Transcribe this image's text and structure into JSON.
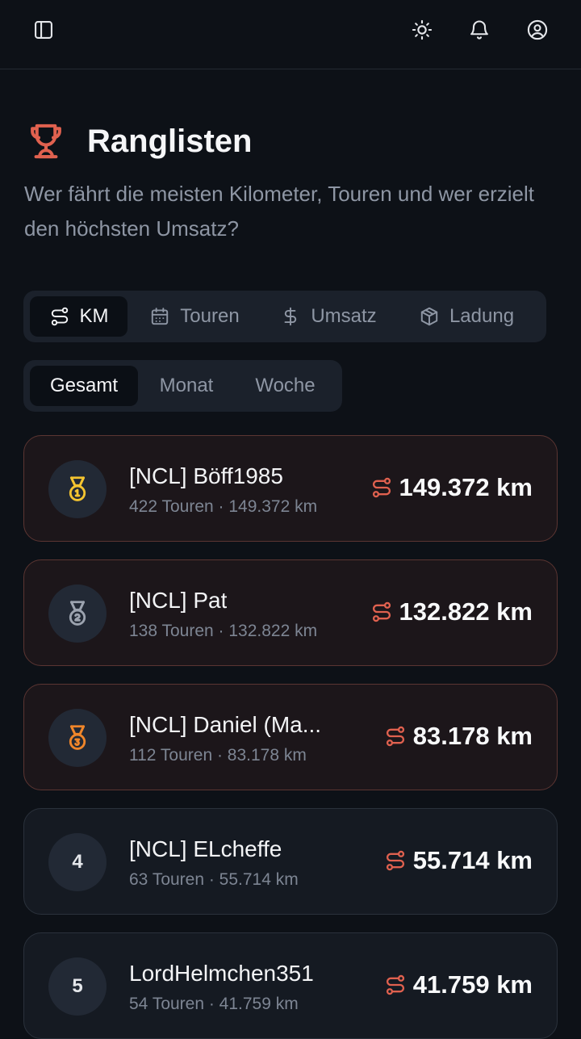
{
  "topbar": {
    "sidebar_icon": "sidebar-toggle-icon",
    "theme_icon": "sun-icon",
    "notify_icon": "bell-icon",
    "profile_icon": "user-circle-icon"
  },
  "header": {
    "icon": "trophy-icon",
    "title": "Ranglisten",
    "subtitle": "Wer fährt die meisten Kilometer, Touren und wer erzielt den höchsten Umsatz?"
  },
  "metric_tabs": [
    {
      "label": "KM",
      "icon": "route-icon",
      "active": true
    },
    {
      "label": "Touren",
      "icon": "calendar-icon",
      "active": false
    },
    {
      "label": "Umsatz",
      "icon": "dollar-icon",
      "active": false
    },
    {
      "label": "Ladung",
      "icon": "package-icon",
      "active": false
    }
  ],
  "period_tabs": [
    {
      "label": "Gesamt",
      "active": true
    },
    {
      "label": "Monat",
      "active": false
    },
    {
      "label": "Woche",
      "active": false
    }
  ],
  "colors": {
    "accent": "#e0614f",
    "gold": "#f4c430",
    "silver": "#9ca3af",
    "bronze": "#f0862a"
  },
  "leaderboard": [
    {
      "rank": "",
      "medal": "gold-medal-icon",
      "name": "[NCL] Böff1985",
      "meta": "422 Touren · 149.372 km",
      "value": "149.372 km"
    },
    {
      "rank": "",
      "medal": "silver-medal-icon",
      "name": "[NCL] Pat",
      "meta": "138 Touren · 132.822 km",
      "value": "132.822 km"
    },
    {
      "rank": "",
      "medal": "bronze-medal-icon",
      "name": "[NCL] Daniel (Ma...",
      "meta": "112 Touren · 83.178 km",
      "value": "83.178 km"
    },
    {
      "rank": "4",
      "medal": "",
      "name": "[NCL] ELcheffe",
      "meta": "63 Touren · 55.714 km",
      "value": "55.714 km"
    },
    {
      "rank": "5",
      "medal": "",
      "name": "LordHelmchen351",
      "meta": "54 Touren · 41.759 km",
      "value": "41.759 km"
    }
  ]
}
